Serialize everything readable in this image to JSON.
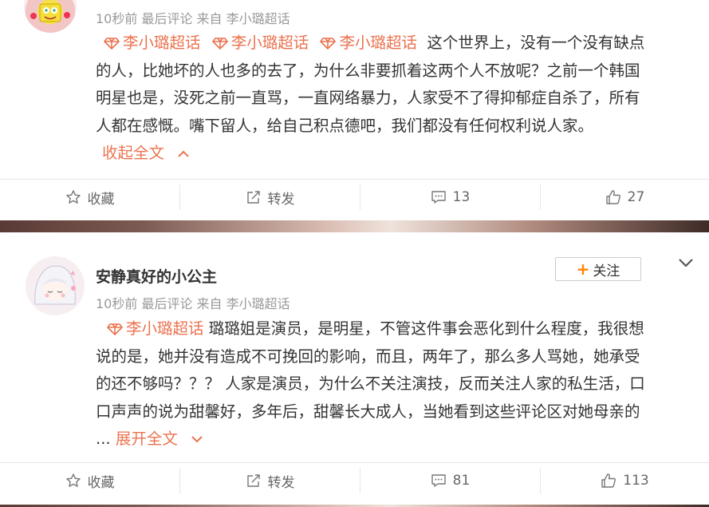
{
  "post1": {
    "meta": "10秒前 最后评论 来自 李小璐超话",
    "topics": [
      "李小璐超话",
      "李小璐超话",
      "李小璐超话"
    ],
    "line1": "这个世界上，没有一个没有缺点",
    "line2": "的人，比她坏的人也多的去了，为什么非要抓着这两个人不放呢？之前一个韩国",
    "line3": "明星也是，没死之前一直骂，一直网络暴力，人家受不了得抑郁症自杀了，所有",
    "line4": "人都在感慨。嘴下留人，给自己积点德吧，我们都没有任何权利说人家。",
    "collapse_label": "收起全文",
    "actions": {
      "favorite": "收藏",
      "repost": "转发",
      "comments": "13",
      "likes": "27"
    }
  },
  "post2": {
    "username": "安静真好的小公主",
    "follow_label": "关注",
    "follow_plus": "+",
    "meta": "10秒前 最后评论 来自 李小璐超话",
    "topic": "李小璐超话",
    "line1": "璐璐姐是演员，是明星，不管这件事会恶化到什么程度，我很想",
    "line2": "说的是，她并没有造成不可挽回的影响，而且，两年了，那么多人骂她，她承受",
    "line3": "的还不够吗？？？ 人家是演员，为什么不关注演技，反而关注人家的私生活，口",
    "line4": "口声声的说为甜馨好，多年后，甜馨长大成人，当她看到这些评论区对她母亲的",
    "ellipsis": "...",
    "expand_label": "展开全文",
    "actions": {
      "favorite": "收藏",
      "repost": "转发",
      "comments": "81",
      "likes": "113"
    }
  },
  "colors": {
    "link": "#eb7350",
    "follow_plus": "#ff8200",
    "meta": "#999999"
  }
}
